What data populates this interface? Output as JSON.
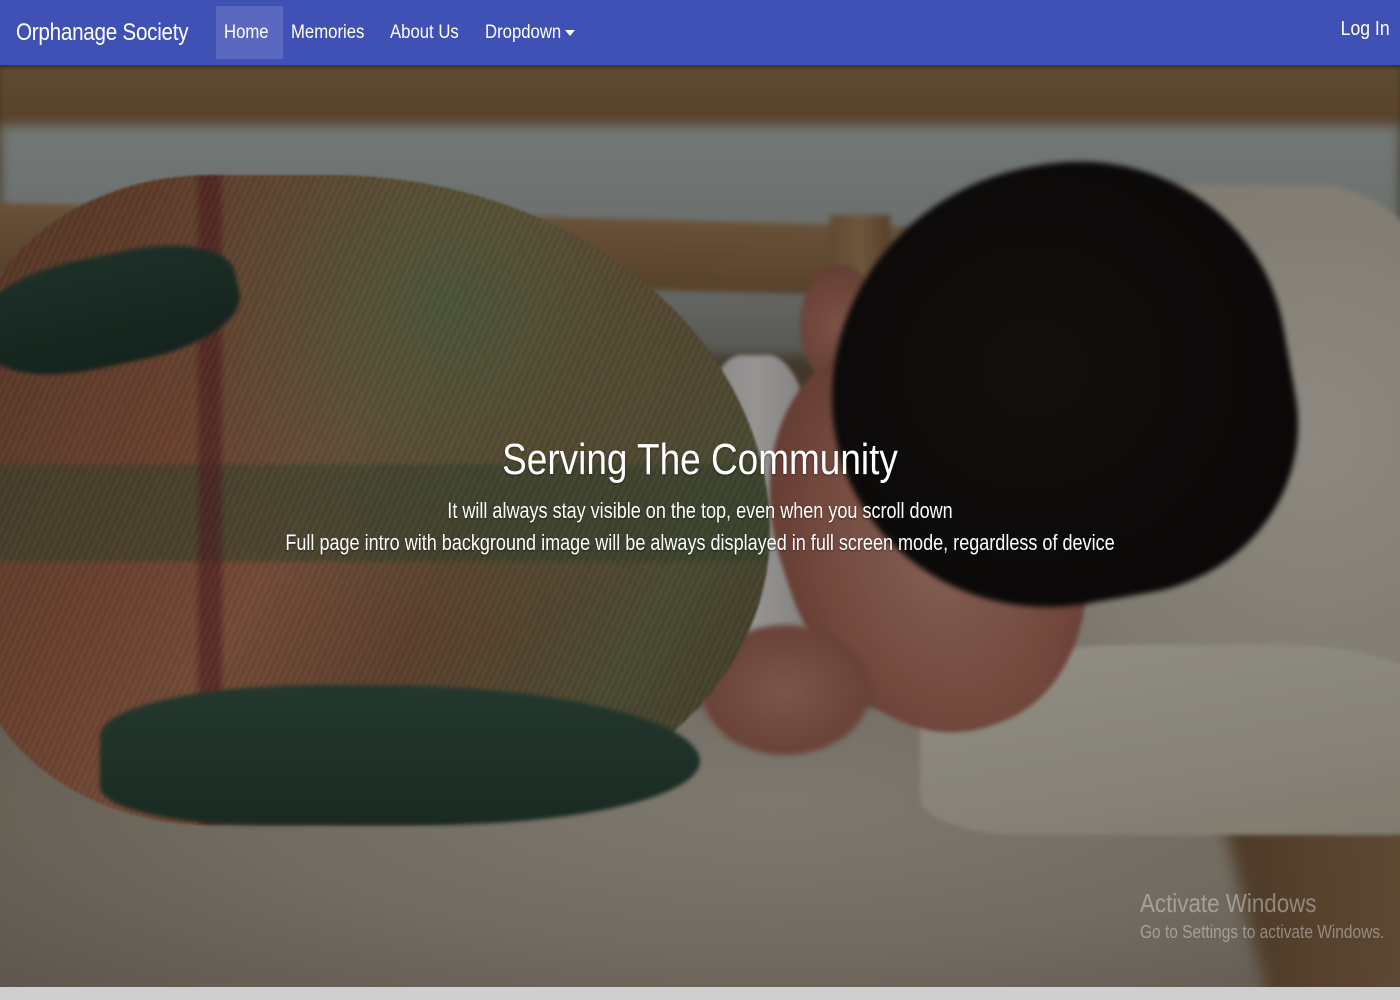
{
  "navbar": {
    "brand": "Orphanage Society",
    "links": [
      {
        "label": "Home",
        "active": true
      },
      {
        "label": "Memories",
        "active": false
      },
      {
        "label": "About Us",
        "active": false
      },
      {
        "label": "Dropdown",
        "active": false
      }
    ],
    "login_label": "Log In",
    "background_color": "#3f51b5"
  },
  "hero": {
    "title": "Serving The Community",
    "line1": "It will always stay visible on the top, even when you scroll down",
    "line2": "Full page intro with background image will be always displayed in full screen mode, regardless of device"
  },
  "watermark": {
    "title": "Activate Windows",
    "subtitle": "Go to Settings to activate Windows."
  }
}
